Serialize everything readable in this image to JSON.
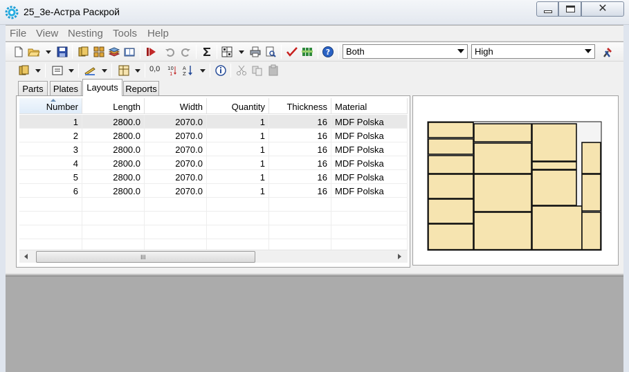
{
  "window": {
    "title": "25_3е-Астра Раскрой",
    "icon": "gear-app-icon",
    "close_glyph": "✕"
  },
  "menu": [
    {
      "label": "File"
    },
    {
      "label": "View"
    },
    {
      "label": "Nesting"
    },
    {
      "label": "Tools"
    },
    {
      "label": "Help"
    }
  ],
  "toolbar": {
    "layer_mode": "Both",
    "quality": "High",
    "decimal_label": "0,0",
    "numbering_label": "10/1"
  },
  "panel_close": "×",
  "tabs": [
    {
      "label": "Parts"
    },
    {
      "label": "Plates"
    },
    {
      "label": "Layouts",
      "active": true
    },
    {
      "label": "Reports"
    }
  ],
  "grid": {
    "columns": [
      "Number",
      "Length",
      "Width",
      "Quantity",
      "Thickness",
      "Material"
    ],
    "rows": [
      {
        "number": "1",
        "length": "2800.0",
        "width": "2070.0",
        "quantity": "1",
        "thickness": "16",
        "material": "MDF Polska"
      },
      {
        "number": "2",
        "length": "2800.0",
        "width": "2070.0",
        "quantity": "1",
        "thickness": "16",
        "material": "MDF Polska"
      },
      {
        "number": "3",
        "length": "2800.0",
        "width": "2070.0",
        "quantity": "1",
        "thickness": "16",
        "material": "MDF Polska"
      },
      {
        "number": "4",
        "length": "2800.0",
        "width": "2070.0",
        "quantity": "1",
        "thickness": "16",
        "material": "MDF Polska"
      },
      {
        "number": "5",
        "length": "2800.0",
        "width": "2070.0",
        "quantity": "1",
        "thickness": "16",
        "material": "MDF Polska"
      },
      {
        "number": "6",
        "length": "2800.0",
        "width": "2070.0",
        "quantity": "1",
        "thickness": "16",
        "material": "MDF Polska"
      }
    ],
    "scroll_grip": "III"
  },
  "colors": {
    "part_fill": "#f6e4b0",
    "part_stroke": "#111111",
    "sheet_fill": "#f4f4f4"
  }
}
